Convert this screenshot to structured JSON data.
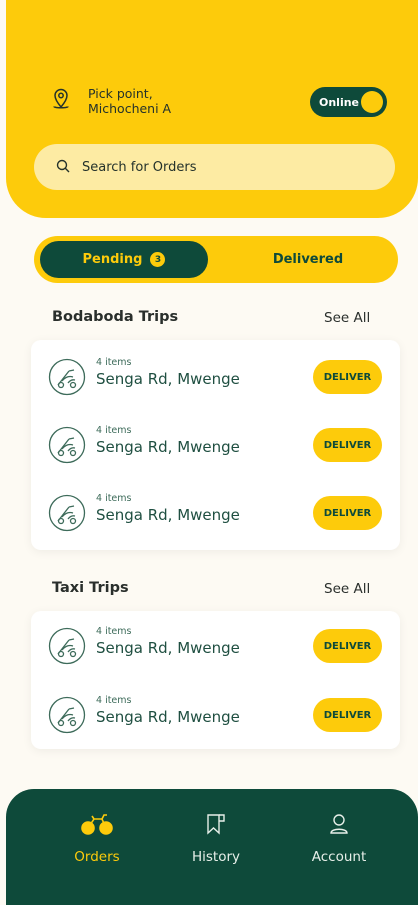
{
  "header": {
    "pick_point": "Pick point,",
    "pick_location": "Michocheni A",
    "status_toggle": "Online",
    "search_placeholder": "Search for Orders"
  },
  "tabs": {
    "pending_label": "Pending",
    "pending_count": "3",
    "delivered_label": "Delivered"
  },
  "sections": [
    {
      "title": "Bodaboda Trips",
      "see_all": "See All",
      "trips": [
        {
          "items": "4 items",
          "place": "Senga Rd, Mwenge",
          "action": "DELIVER"
        },
        {
          "items": "4 items",
          "place": "Senga Rd, Mwenge",
          "action": "DELIVER"
        },
        {
          "items": "4 items",
          "place": "Senga Rd, Mwenge",
          "action": "DELIVER"
        }
      ]
    },
    {
      "title": "Taxi Trips",
      "see_all": "See All",
      "trips": [
        {
          "items": "4 items",
          "place": "Senga Rd, Mwenge",
          "action": "DELIVER"
        },
        {
          "items": "4 items",
          "place": "Senga Rd, Mwenge",
          "action": "DELIVER"
        }
      ]
    }
  ],
  "nav": {
    "orders": "Orders",
    "history": "History",
    "account": "Account"
  },
  "colors": {
    "brand_yellow": "#fdcb0b",
    "brand_green": "#0e4a3a",
    "background": "#fdfaf3"
  }
}
